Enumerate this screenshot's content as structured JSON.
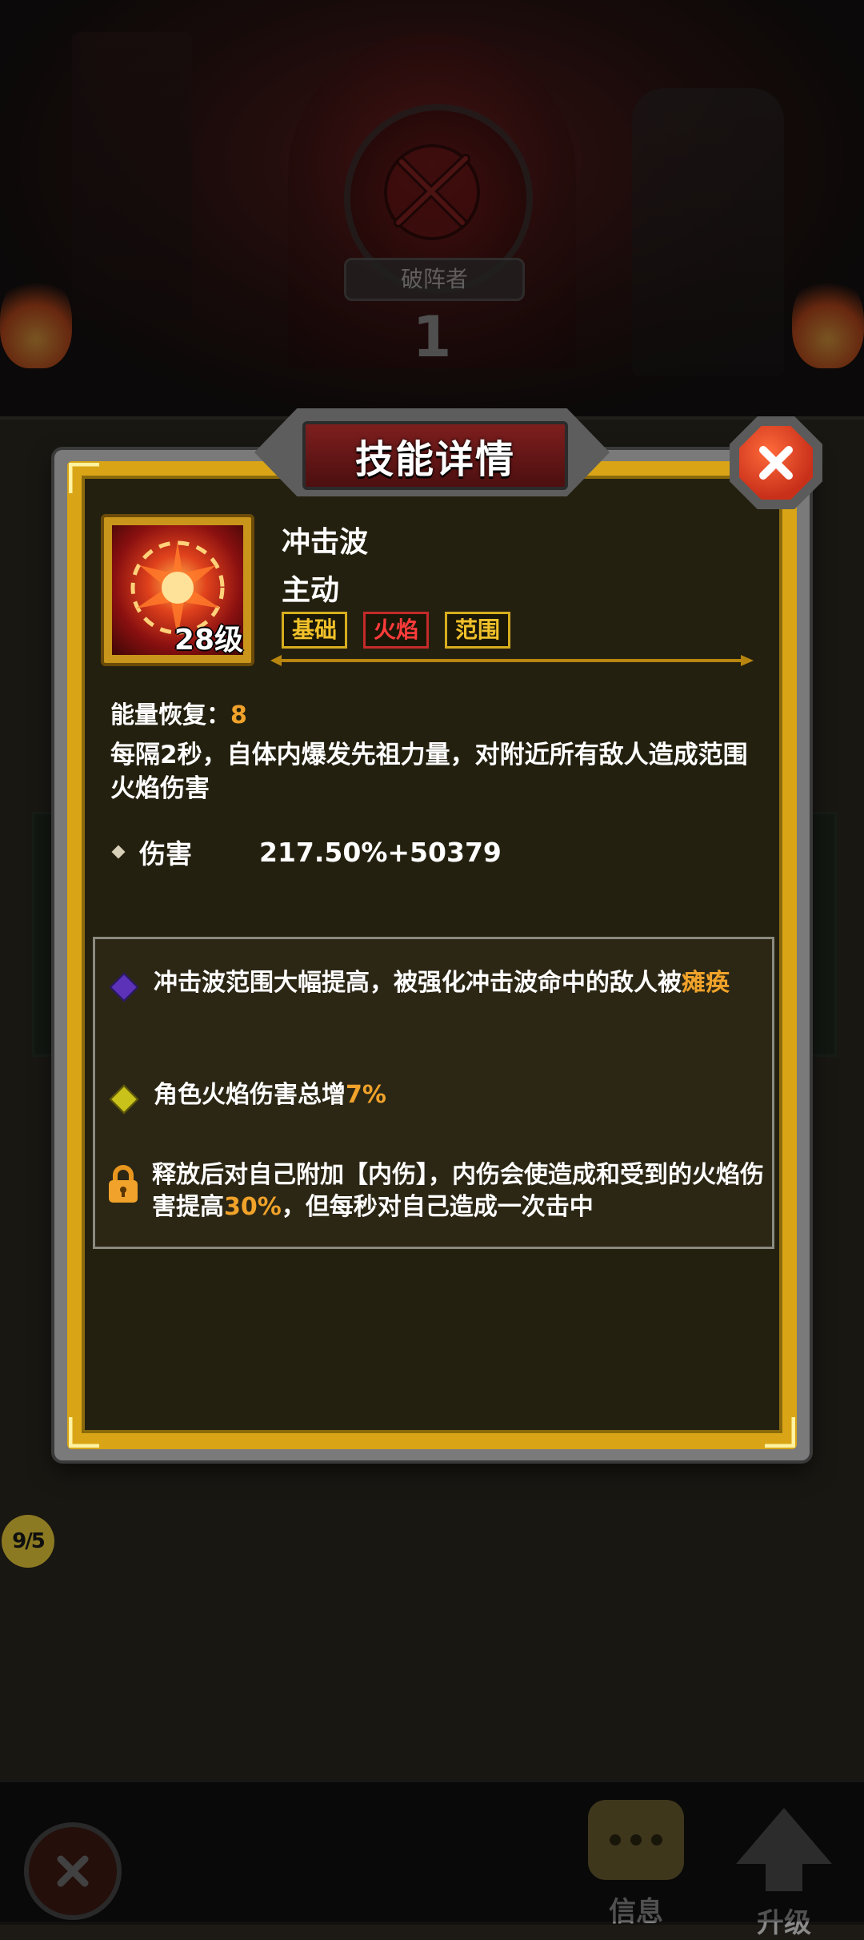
{
  "hero": {
    "class_name": "破阵者",
    "number": "1"
  },
  "dialog": {
    "title": "技能详情",
    "skill": {
      "name": "冲击波",
      "type": "主动",
      "level": "28级",
      "tags": [
        "基础",
        "火焰",
        "范围"
      ],
      "energy_label": "能量恢复：",
      "energy_value": "8",
      "description": "每隔2秒，自体内爆发先祖力量，对附近所有敌人造成范围火焰伤害",
      "stat_label": "伤害",
      "stat_value": "217.50%+50379"
    },
    "perks": [
      {
        "icon": "purple-diamond-icon",
        "text_before": "冲击波范围大幅提高，被强化冲击波命中的敌人被",
        "highlight": "瘫痪",
        "text_after": ""
      },
      {
        "icon": "yellow-diamond-icon",
        "text_before": "角色火焰伤害总增",
        "highlight": "7%",
        "text_after": ""
      },
      {
        "icon": "lock-icon",
        "text_before": "释放后对自己附加【内伤】，内伤会使造成和受到的火焰伤害提高",
        "highlight": "30%",
        "text_after": "，但每秒对自己造成一次击中"
      }
    ]
  },
  "progress_chip": "9/5",
  "bottom_bar": {
    "info_label": "信息",
    "upgrade_label": "升级"
  },
  "colors": {
    "gold": "#d9a516",
    "highlight": "#f0a22a",
    "fire_tag": "#ff3b3b",
    "title_red": "#7e1e1e"
  }
}
